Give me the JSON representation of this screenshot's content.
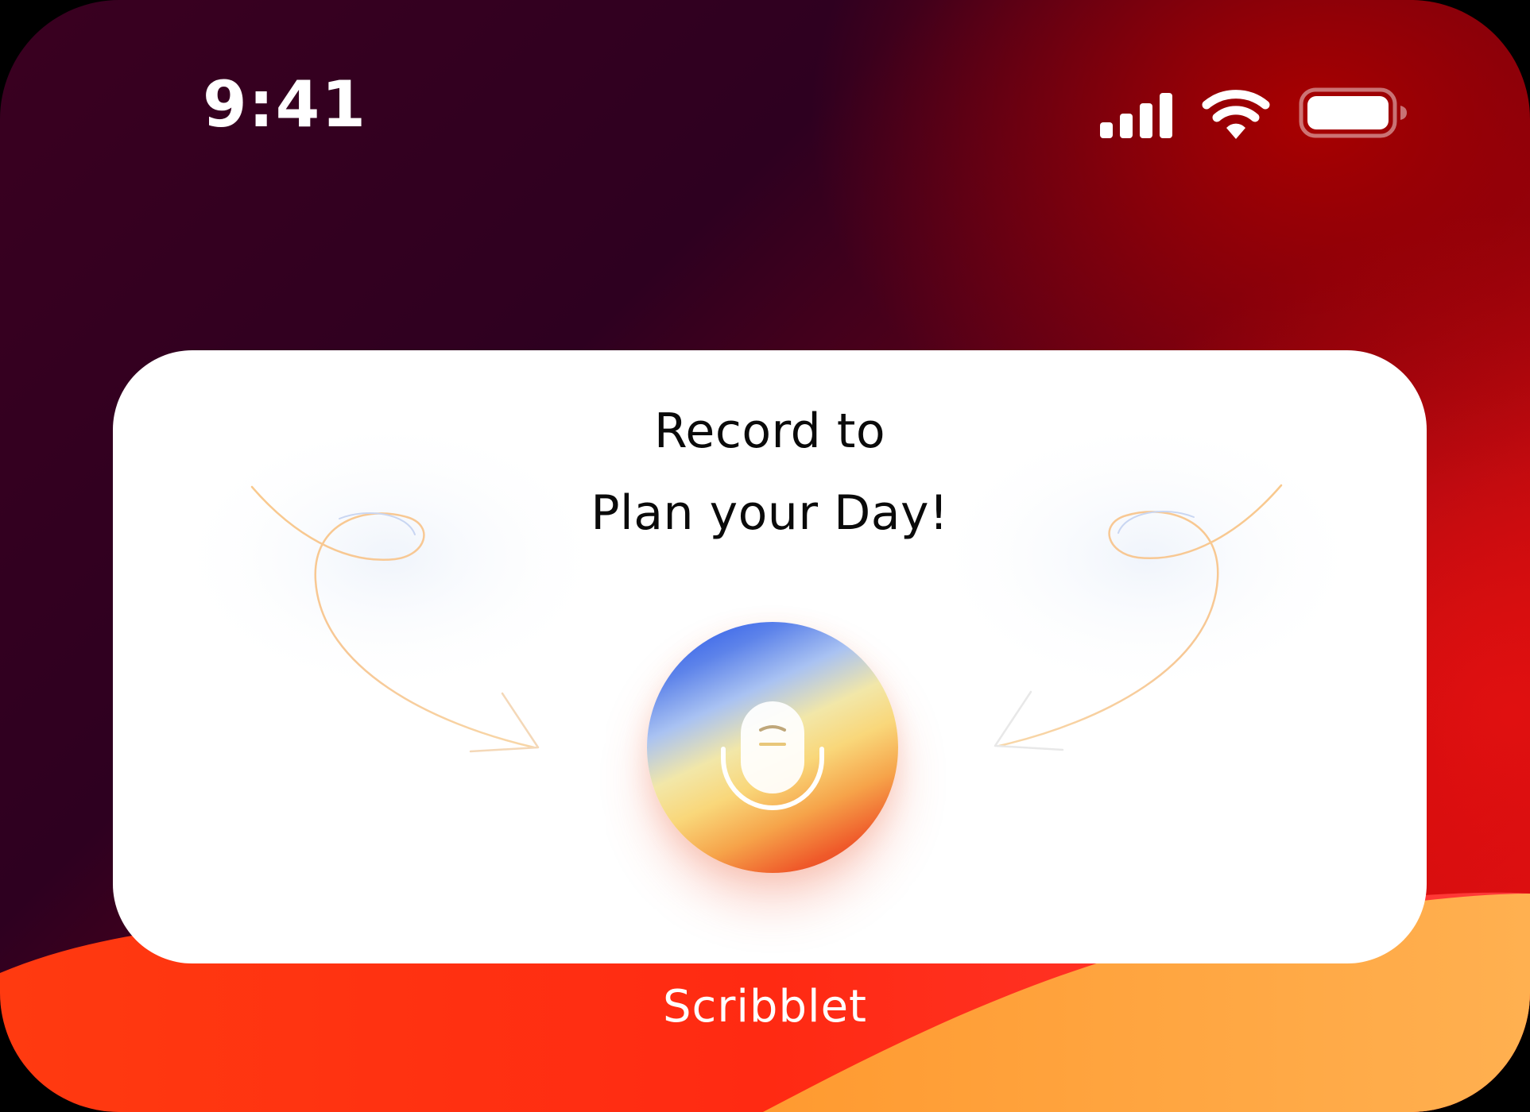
{
  "status_bar": {
    "time": "9:41",
    "signal_icon": "cellular-signal-icon",
    "wifi_icon": "wifi-icon",
    "battery_icon": "battery-icon"
  },
  "widget": {
    "title_line1": "Record to",
    "title_line2": "Plan your Day!",
    "record_button_icon": "microphone-icon",
    "decoration": "curly-arrow-icon"
  },
  "home_screen": {
    "app_name": "Scribblet"
  },
  "colors": {
    "wallpaper_dark": "#3a0020",
    "wallpaper_red": "#e01010",
    "wallpaper_orange": "#ff8c2a",
    "widget_background": "#ffffff",
    "title_text": "#0a0a0a",
    "mic_blue": "#1f4fe8",
    "mic_yellow": "#f9d77a",
    "mic_red": "#e8341f"
  }
}
